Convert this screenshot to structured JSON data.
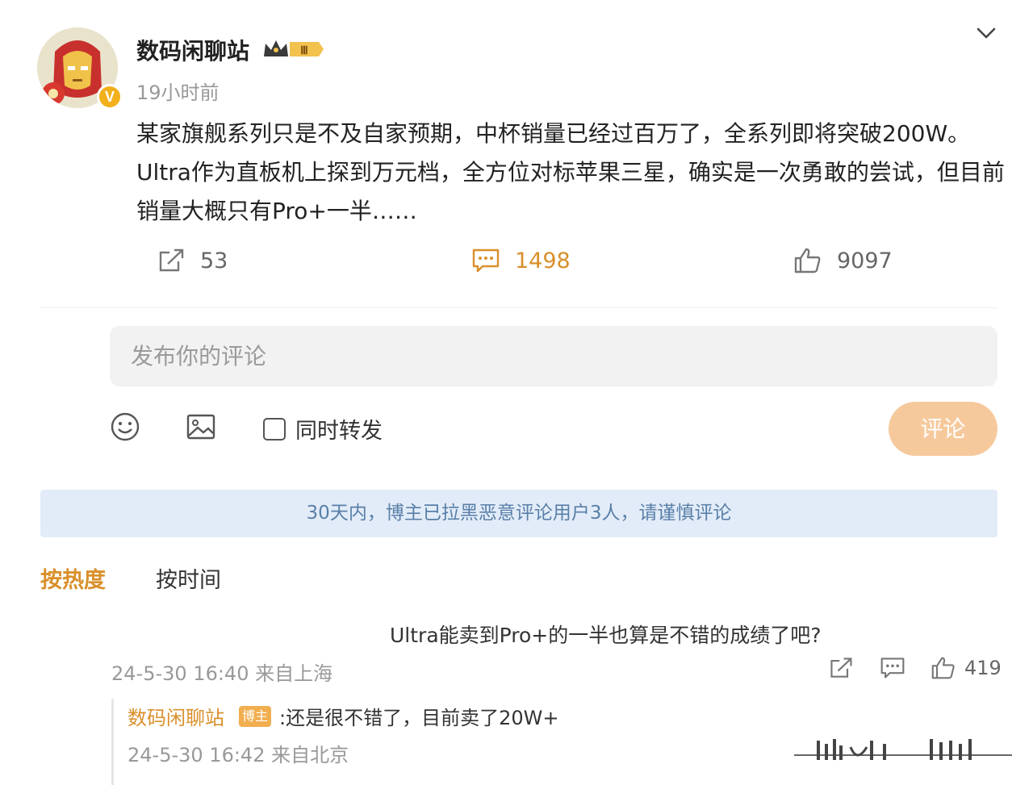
{
  "post": {
    "author": "数码闲聊站",
    "avatar_badge": "V",
    "level_badge": "Ⅲ",
    "time": "19小时前",
    "content": "某家旗舰系列只是不及自家预期，中杯销量已经过百万了，全系列即将突破200W。Ultra作为直板机上探到万元档，全方位对标苹果三星，确实是一次勇敢的尝试，但目前销量大概只有Pro+一半……",
    "reposts": "53",
    "comments": "1498",
    "likes": "9097"
  },
  "composer": {
    "placeholder": "发布你的评论",
    "repost_label": "同时转发",
    "submit_label": "评论"
  },
  "notice": "30天内，博主已拉黑恶意评论用户3人，请谨慎评论",
  "sort": {
    "hot": "按热度",
    "time": "按时间"
  },
  "comment": {
    "text": "Ultra能卖到Pro+的一半也算是不错的成绩了吧?",
    "time": "24-5-30 16:40 来自上海",
    "likes": "419"
  },
  "reply": {
    "author": "数码闲聊站",
    "badge": "博主",
    "text": ":还是很不错了，目前卖了20W+",
    "time": "24-5-30 16:42 来自北京"
  },
  "icons": [
    "chevron-down-icon",
    "repost-icon",
    "comment-icon",
    "like-icon",
    "emoji-icon",
    "image-icon"
  ],
  "colors": {
    "accent": "#d9902b",
    "submit_bg": "#f6c99c",
    "notice_bg": "#e2ecf8",
    "notice_text": "#5a7fa8"
  }
}
